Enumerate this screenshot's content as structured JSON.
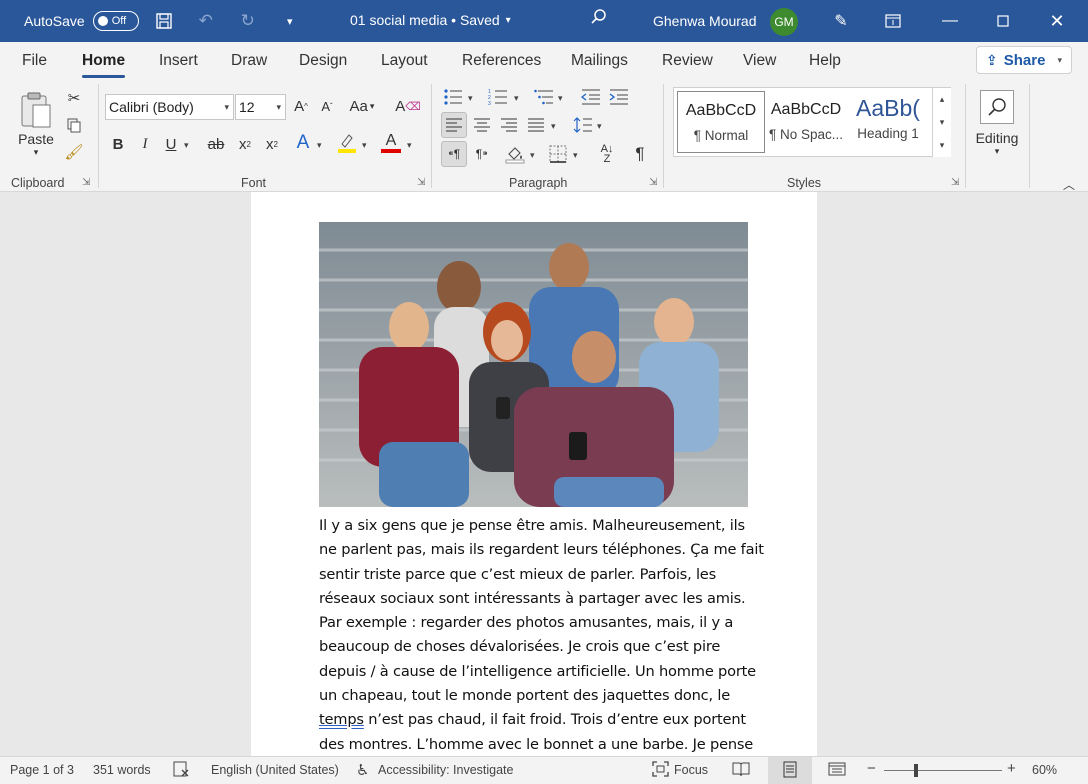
{
  "titlebar": {
    "autosave_label": "AutoSave",
    "autosave_state": "Off",
    "doc_title": "01 social media • Saved",
    "user_name": "Ghenwa Mourad",
    "user_initials": "GM",
    "accent_color": "#2a579a"
  },
  "tabs": [
    "File",
    "Home",
    "Insert",
    "Draw",
    "Design",
    "Layout",
    "References",
    "Mailings",
    "Review",
    "View",
    "Help"
  ],
  "active_tab": "Home",
  "share_label": "Share",
  "ribbon": {
    "clipboard": {
      "paste_label": "Paste",
      "group_label": "Clipboard"
    },
    "font": {
      "font_name": "Calibri (Body)",
      "font_size": "12",
      "case_label": "Aa",
      "group_label": "Font"
    },
    "paragraph": {
      "group_label": "Paragraph"
    },
    "styles": {
      "group_label": "Styles",
      "items": [
        {
          "sample": "AaBbCcD",
          "name": "¶ Normal"
        },
        {
          "sample": "AaBbCcD",
          "name": "¶ No Spac..."
        },
        {
          "sample": "AaBb(",
          "name": "Heading 1"
        }
      ]
    },
    "editing": {
      "label": "Editing"
    }
  },
  "document": {
    "lines": [
      "Il y a six gens que je pense être amis. Malheureusement, ils",
      "ne parlent pas, mais ils regardent leurs téléphones. Ça me fait",
      "sentir triste parce que c’est mieux de parler. Parfois, les",
      "réseaux sociaux sont intéressants à partager avec les amis.",
      "Par exemple : regarder des photos amusantes, mais, il y a",
      "beaucoup de choses dévalorisées. Je crois que c’est pire",
      "depuis / à cause de l’intelligence artificielle. Un homme porte",
      "un chapeau, tout le monde portent des jaquettes donc, le"
    ],
    "line9_underlined": "temps",
    "line9_rest": " n’est pas chaud, il fait froid. Trois d’entre eux portent",
    "line10": "des montres. L’homme avec le bonnet a une barbe. Je pense"
  },
  "statusbar": {
    "page": "Page 1 of 3",
    "words": "351 words",
    "language": "English (United States)",
    "accessibility": "Accessibility: Investigate",
    "focus": "Focus",
    "zoom": "60%"
  }
}
